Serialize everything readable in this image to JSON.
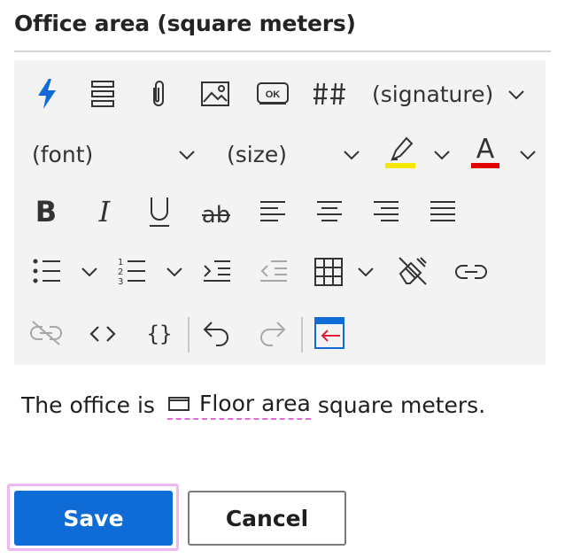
{
  "dialog": {
    "title": "Office area (square meters)"
  },
  "toolbar": {
    "signature_label": "(signature)",
    "font_label": "(font)",
    "size_label": "(size)",
    "highlight_color": "#f5e800",
    "font_color": "#e00000",
    "accent_color": "#0f6cd6"
  },
  "editor": {
    "before": "The office is",
    "placeholder": "Floor area",
    "after": "square meters."
  },
  "actions": {
    "save_label": "Save",
    "cancel_label": "Cancel"
  }
}
